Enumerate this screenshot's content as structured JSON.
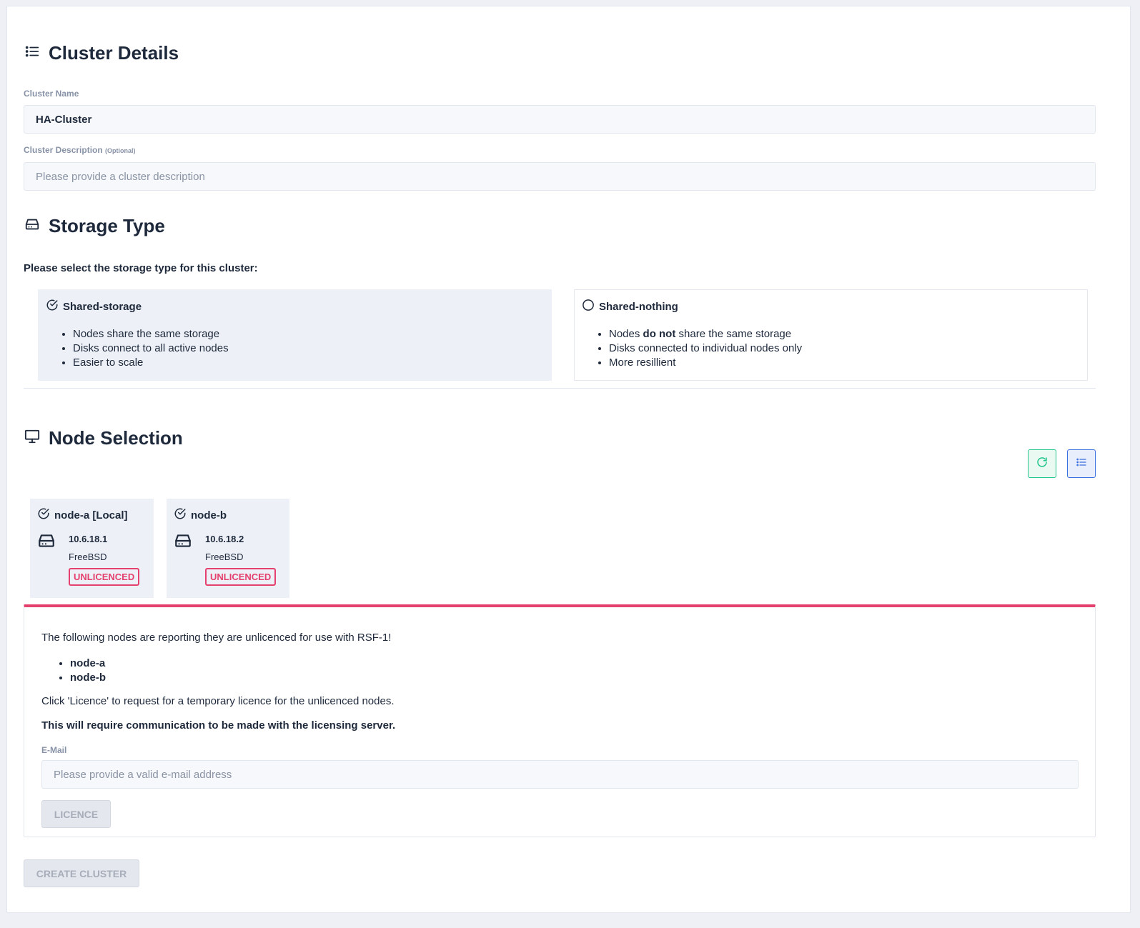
{
  "cluster_details": {
    "title": "Cluster Details",
    "name_label": "Cluster Name",
    "name_value": "HA-Cluster",
    "description_label": "Cluster Description",
    "description_optional": "(Optional)",
    "description_placeholder": "Please provide a cluster description"
  },
  "storage_type": {
    "title": "Storage Type",
    "prompt": "Please select the storage type for this cluster:",
    "options": [
      {
        "label": "Shared-storage",
        "selected": true,
        "bullets": [
          "Nodes share the same storage",
          "Disks connect to all active nodes",
          "Easier to scale"
        ]
      },
      {
        "label": "Shared-nothing",
        "selected": false,
        "bullets_prefix": "Nodes",
        "bullets_bold": "do not",
        "bullets_suffix": "share the same storage",
        "bullets": [
          "Disks connected to individual nodes only",
          "More resillient"
        ]
      }
    ]
  },
  "node_selection": {
    "title": "Node Selection",
    "refresh_icon": "refresh-icon",
    "list_icon": "list-icon",
    "nodes": [
      {
        "name": "node-a [Local]",
        "ip": "10.6.18.1",
        "os": "FreeBSD",
        "status": "UNLICENCED"
      },
      {
        "name": "node-b",
        "ip": "10.6.18.2",
        "os": "FreeBSD",
        "status": "UNLICENCED"
      }
    ]
  },
  "licence_alert": {
    "message": "The following nodes are reporting they are unlicenced for use with RSF-1!",
    "nodes": [
      "node-a",
      "node-b"
    ],
    "instruction": "Click 'Licence' to request for a temporary licence for the unlicenced nodes.",
    "warning": "This will require communication to be made with the licensing server.",
    "email_label": "E-Mail",
    "email_placeholder": "Please provide a valid e-mail address",
    "licence_button": "LICENCE"
  },
  "create_button": "CREATE CLUSTER",
  "colors": {
    "accent_red": "#e5416e",
    "accent_green": "#22c58b",
    "accent_blue": "#3b6fe0"
  }
}
